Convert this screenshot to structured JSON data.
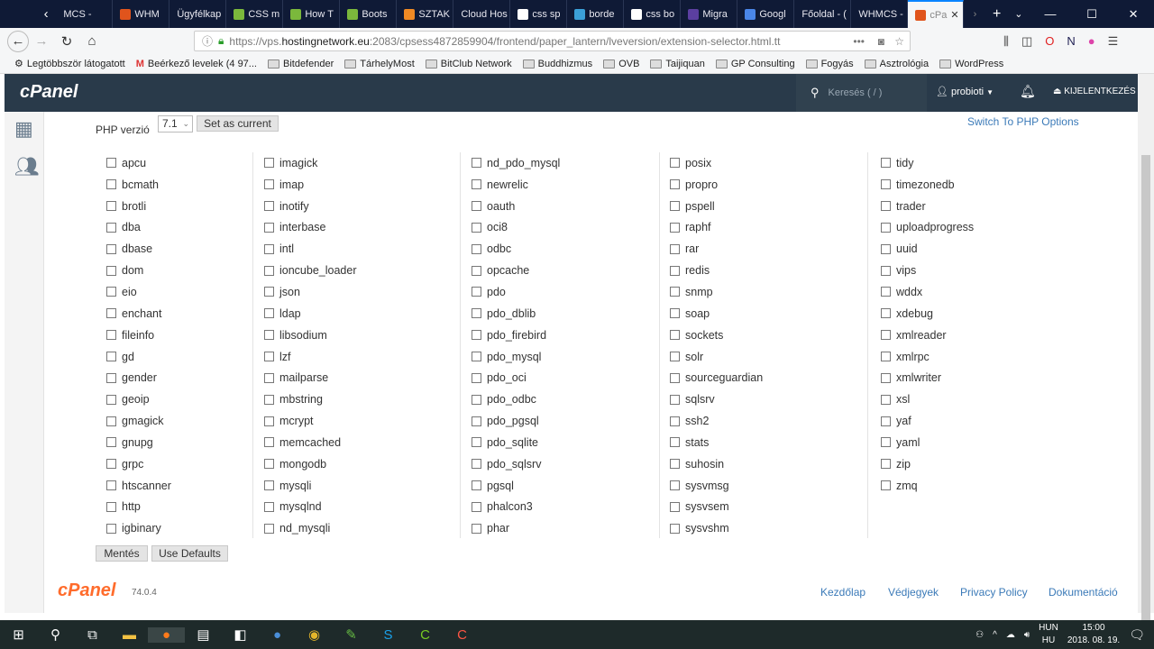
{
  "browser": {
    "tabs": [
      "MCS -",
      "WHM",
      "Ügyfélkap",
      "CSS m",
      "How T",
      "Boots",
      "SZTAK",
      "Cloud Hos",
      "css sp",
      "borde",
      "css bo",
      "Migra",
      "Googl",
      "Főoldal - (",
      "WHMCS -",
      "cPa"
    ],
    "url": {
      "prefix": "https://vps.",
      "domain": "hostingnetwork.eu",
      "rest": ":2083/cpsess4872859904/frontend/paper_lantern/lveversion/extension-selector.html.tt"
    },
    "bookmarks": [
      "Legtöbbször látogatott",
      "Beérkező levelek (4 97...",
      "Bitdefender",
      "TárhelyMost",
      "BitClub Network",
      "Buddhizmus",
      "OVB",
      "Taijiquan",
      "GP Consulting",
      "Fogyás",
      "Asztrológia",
      "WordPress"
    ]
  },
  "header": {
    "logo": "cPanel",
    "search_placeholder": "Keresés ( / )",
    "user": "probioti",
    "logout": "KIJELENTKEZÉS"
  },
  "main": {
    "php_label": "PHP verzió",
    "php_version": "7.1",
    "set_current": "Set as current",
    "switch_link": "Switch To PHP Options",
    "columns": [
      [
        "apcu",
        "bcmath",
        "brotli",
        "dba",
        "dbase",
        "dom",
        "eio",
        "enchant",
        "fileinfo",
        "gd",
        "gender",
        "geoip",
        "gmagick",
        "gnupg",
        "grpc",
        "htscanner",
        "http",
        "igbinary"
      ],
      [
        "imagick",
        "imap",
        "inotify",
        "interbase",
        "intl",
        "ioncube_loader",
        "json",
        "ldap",
        "libsodium",
        "lzf",
        "mailparse",
        "mbstring",
        "mcrypt",
        "memcached",
        "mongodb",
        "mysqli",
        "mysqlnd",
        "nd_mysqli"
      ],
      [
        "nd_pdo_mysql",
        "newrelic",
        "oauth",
        "oci8",
        "odbc",
        "opcache",
        "pdo",
        "pdo_dblib",
        "pdo_firebird",
        "pdo_mysql",
        "pdo_oci",
        "pdo_odbc",
        "pdo_pgsql",
        "pdo_sqlite",
        "pdo_sqlsrv",
        "pgsql",
        "phalcon3",
        "phar"
      ],
      [
        "posix",
        "propro",
        "pspell",
        "raphf",
        "rar",
        "redis",
        "snmp",
        "soap",
        "sockets",
        "solr",
        "sourceguardian",
        "sqlsrv",
        "ssh2",
        "stats",
        "suhosin",
        "sysvmsg",
        "sysvsem",
        "sysvshm"
      ],
      [
        "tidy",
        "timezonedb",
        "trader",
        "uploadprogress",
        "uuid",
        "vips",
        "wddx",
        "xdebug",
        "xmlreader",
        "xmlrpc",
        "xmlwriter",
        "xsl",
        "yaf",
        "yaml",
        "zip",
        "zmq"
      ]
    ],
    "save": "Mentés",
    "defaults": "Use Defaults"
  },
  "footer": {
    "logo": "cPanel",
    "version": "74.0.4",
    "links": [
      "Kezdőlap",
      "Védjegyek",
      "Privacy Policy",
      "Dokumentáció"
    ]
  },
  "taskbar": {
    "lang1": "HUN",
    "lang2": "HU",
    "time": "15:00",
    "date": "2018. 08. 19."
  }
}
